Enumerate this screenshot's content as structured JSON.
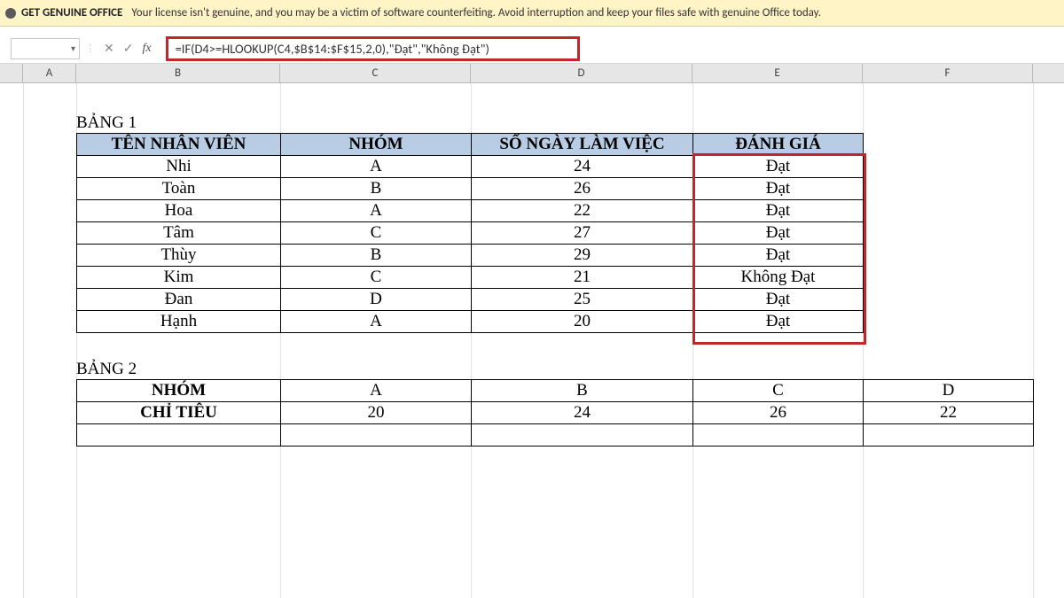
{
  "banner": {
    "title": "GET GENUINE OFFICE",
    "message": "Your license isn't genuine, and you may be a victim of software counterfeiting. Avoid interruption and keep your files safe with genuine Office today."
  },
  "formula_bar": {
    "cancel_glyph": "✕",
    "enter_glyph": "✓",
    "fx_label": "fx",
    "formula": "=IF(D4>=HLOOKUP(C4,$B$14:$F$15,2,0),\"Đạt\",\"Không Đạt\")"
  },
  "columns": [
    "A",
    "B",
    "C",
    "D",
    "E",
    "F"
  ],
  "sheet": {
    "bang1_title": "BẢNG 1",
    "table1_headers": [
      "TÊN NHÂN VIÊN",
      "NHÓM",
      "SỐ NGÀY LÀM VIỆC",
      "ĐÁNH GIÁ"
    ],
    "table1_rows": [
      {
        "ten": "Nhi",
        "nhom": "A",
        "songay": "24",
        "danhgia": "Đạt"
      },
      {
        "ten": "Toàn",
        "nhom": "B",
        "songay": "26",
        "danhgia": "Đạt"
      },
      {
        "ten": "Hoa",
        "nhom": "A",
        "songay": "22",
        "danhgia": "Đạt"
      },
      {
        "ten": "Tâm",
        "nhom": "C",
        "songay": "27",
        "danhgia": "Đạt"
      },
      {
        "ten": "Thùy",
        "nhom": "B",
        "songay": "29",
        "danhgia": "Đạt"
      },
      {
        "ten": "Kim",
        "nhom": "C",
        "songay": "21",
        "danhgia": "Không Đạt"
      },
      {
        "ten": "Đan",
        "nhom": "D",
        "songay": "25",
        "danhgia": "Đạt"
      },
      {
        "ten": "Hạnh",
        "nhom": "A",
        "songay": "20",
        "danhgia": "Đạt"
      }
    ],
    "bang2_title": "BẢNG 2",
    "table2": {
      "row1_label": "NHÓM",
      "row1_vals": [
        "A",
        "B",
        "C",
        "D"
      ],
      "row2_label": "CHỈ TIÊU",
      "row2_vals": [
        "20",
        "24",
        "26",
        "22"
      ]
    }
  }
}
